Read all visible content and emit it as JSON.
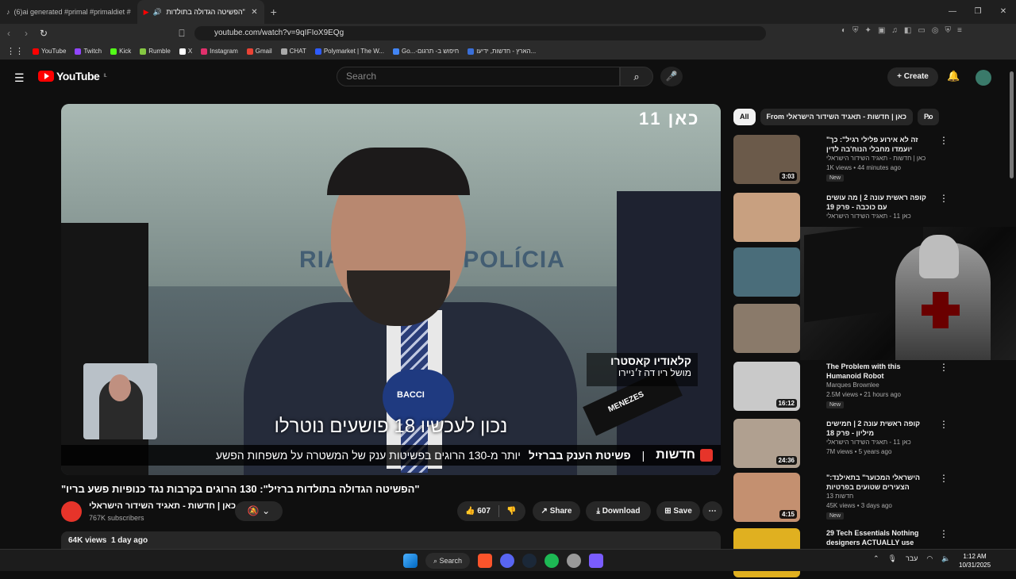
{
  "browser": {
    "tabs": [
      {
        "title": "(6)ai generated #primal #primaldiet #"
      },
      {
        "title": "\"הפשיטה הגדולה בתולדות בר",
        "active": true
      }
    ],
    "new_tab": "+",
    "url": "youtube.com/watch?v=9qIFIoX9EQg",
    "bookmarks": [
      {
        "label": "YouTube",
        "color": "#ff0000"
      },
      {
        "label": "Twitch",
        "color": "#9146ff"
      },
      {
        "label": "Kick",
        "color": "#53fc18"
      },
      {
        "label": "Rumble",
        "color": "#85c742"
      },
      {
        "label": "X",
        "color": "#ffffff"
      },
      {
        "label": "Instagram",
        "color": "#e1306c"
      },
      {
        "label": "Gmail",
        "color": "#ea4335"
      },
      {
        "label": "CHAT",
        "color": "#aaaaaa"
      },
      {
        "label": "Polymarket | The W...",
        "color": "#2e5cff"
      },
      {
        "label": "Go...-חיפוש ב- תרגום",
        "color": "#4285f4"
      },
      {
        "label": "הארץ - חדשות, ידיעו...",
        "color": "#3a6fd8"
      }
    ]
  },
  "youtube": {
    "logo": "YouTube",
    "region": "IL",
    "search_placeholder": "Search",
    "create_label": "Create"
  },
  "video": {
    "channel_watermark": "כאן 11",
    "wall_text": "RIA DE ... DE POLÍCIA",
    "lower_third_name": "קלאודיו קאסטרו",
    "lower_third_role": "מושל ריו דה ז׳ניירו",
    "caption": "נכון לעכשיו 18 פושעים נוטרלו",
    "ticker_news": "חדשות",
    "ticker_headline": "פשיטת הענק בברזיל",
    "ticker_text": "יותר מ-130 הרוגים בפשיטות ענק של המשטרה על משפחות הפשע",
    "mic1_label": "BACCI",
    "mic2_label": "MENEZES",
    "title": "\"הפשיטה הגדולה בתולדות ברזיל\": 130 הרוגים בקרבות נגד כנופיות פשע בריו\"",
    "channel_name": "כאן | חדשות - תאגיד השידור הישראלי",
    "subscribers": "767K subscribers",
    "likes": "607",
    "share_label": "Share",
    "download_label": "Download",
    "save_label": "Save",
    "views": "64K views",
    "age": "1 day ago"
  },
  "sidebar": {
    "chips": [
      "All",
      "From כאן | חדשות - תאגיד השידור הישראלי",
      "Po"
    ],
    "items": [
      {
        "title": "\"זה לא אירוע פלילי רגיל\": כך יועמדו מחבלי הנוח'בה לדין",
        "channel": "כאן | חדשות - תאגיד השידור הישראלי",
        "views": "1K views",
        "age": "44 minutes ago",
        "badge": "New",
        "duration": "3:03",
        "thumb_color": "#6b5a4a"
      },
      {
        "title": "קופה ראשית עונה 2 | מה עושים עם כוכבה - פרק 19",
        "channel": "כאן 11 - תאגיד השידור הישראלי",
        "views": "",
        "age": "",
        "badge": "",
        "duration": "",
        "thumb_color": "#c8a080"
      },
      {
        "title": "",
        "channel": "",
        "views": "",
        "age": "",
        "badge": "",
        "duration": "",
        "thumb_color": "#4a6d7a"
      },
      {
        "title": "",
        "channel": "",
        "views": "",
        "age": "",
        "badge": "",
        "duration": "",
        "thumb_color": "#8a7a6a"
      },
      {
        "title": "The Problem with this Humanoid Robot",
        "channel": "Marques Brownlee",
        "views": "2.5M views",
        "age": "21 hours ago",
        "badge": "New",
        "duration": "16:12",
        "thumb_color": "#c9c9c9"
      },
      {
        "title": "קופה ראשית עונה 2 | חמישים מיליון - פרק 18",
        "channel": "כאן 11 - תאגיד השידור הישראלי",
        "views": "7M views",
        "age": "5 years ago",
        "badge": "",
        "duration": "24:36",
        "thumb_color": "#b0a090"
      },
      {
        "title": "\"הישראלי המכוער\" בתאילנד: הצעירים שטועים בפרטיות המקומיים",
        "channel": "חדשות 13",
        "views": "45K views",
        "age": "3 days ago",
        "badge": "New",
        "duration": "4:15",
        "thumb_color": "#c49070"
      },
      {
        "title": "29 Tech Essentials Nothing designers ACTUALLY use",
        "channel": "",
        "views": "",
        "age": "",
        "badge": "",
        "duration": "",
        "thumb_color": "#e0b020"
      }
    ]
  },
  "taskbar": {
    "search_label": "Search",
    "lang": "עבר",
    "time": "1:12 AM",
    "date": "10/31/2025"
  }
}
